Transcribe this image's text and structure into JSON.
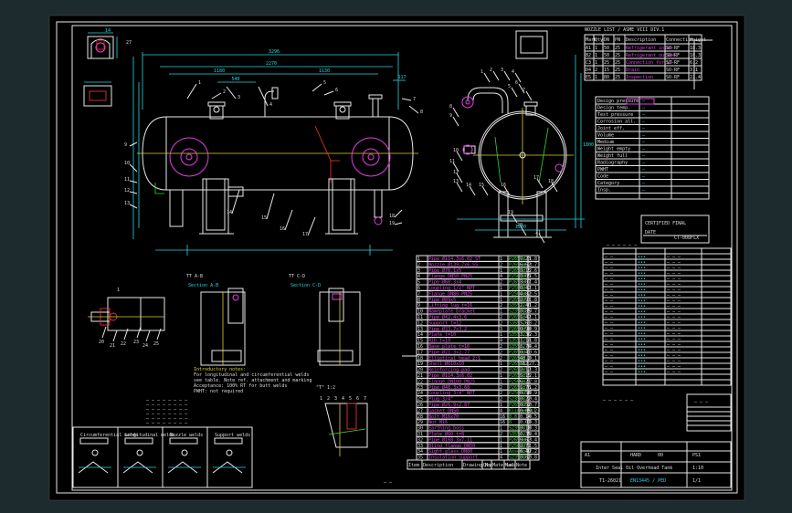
{
  "drawing": {
    "section_ab": "Section A-B",
    "section_cd": "Section C-D",
    "detail_title": "\"Y\" 1:2",
    "section_ab_scale": "TT A-B",
    "section_cd_scale": "TT C-D",
    "view_label": "\"T\" 1:2"
  },
  "callouts": {
    "main_view": [
      "1",
      "2",
      "3",
      "4",
      "5",
      "6",
      "7",
      "8",
      "9",
      "10",
      "11",
      "12",
      "13",
      "14",
      "15",
      "16",
      "17",
      "18",
      "19",
      "20",
      "21",
      "22",
      "23",
      "24",
      "25",
      "26",
      "27",
      "28",
      "29",
      "30",
      "31",
      "32",
      "33",
      "34",
      "35"
    ],
    "side_view": [
      "1",
      "2",
      "3",
      "4",
      "5",
      "6",
      "7",
      "8",
      "9",
      "10",
      "11",
      "12",
      "13",
      "14",
      "15",
      "16",
      "17",
      "18",
      "19",
      "20",
      "21"
    ],
    "detail_view": [
      "1",
      "2",
      "3",
      "4",
      "5",
      "6",
      "7"
    ]
  },
  "dimensions": {
    "overall_length": "3296",
    "shell_length": "2950",
    "top_a": "2270",
    "top_b": "1180",
    "top_c": "1130",
    "top_d": "540",
    "side_width": "1200",
    "side_height": "1800",
    "nozzle": "117"
  },
  "certificate": {
    "title": "CERTIFIED FINAL",
    "line1": "DATE",
    "line2": "CT-008FLX"
  },
  "nozzle_table": {
    "header": [
      "Mark",
      "Qty",
      "DN",
      "PN",
      "Description",
      "Connection",
      "Weight"
    ],
    "rows": [
      [
        "A1",
        "1",
        "50",
        "25",
        "Refrigerant inlet",
        "SO-RF",
        "18.3"
      ],
      [
        "B2",
        "1",
        "50",
        "25",
        "Refrigerant outlet",
        "SO-RF",
        "18.3"
      ],
      [
        "C3",
        "1",
        "25",
        "25",
        "Connection for LT",
        "SO-RF",
        "6.2"
      ],
      [
        "D4",
        "2",
        "15",
        "25",
        "Drain",
        "SO-RF",
        "3.1"
      ],
      [
        "E5",
        "1",
        "80",
        "25",
        "Inspection",
        "SO-RF",
        "22.4"
      ]
    ]
  },
  "parts_list": {
    "header": [
      "Pos",
      "Description",
      "Qty",
      "Material",
      "Mass",
      "Note"
    ],
    "rows": [
      [
        "1",
        "Pipe Ø114.3x6.02 ST",
        "1",
        "P265GH",
        "7.23",
        "1.8"
      ],
      [
        "2",
        "Nozzle Ø139.7x6.55",
        "2",
        "P265GH",
        "6.62",
        "3.7"
      ],
      [
        "3",
        "Pipe Ø76.1x5",
        "1",
        "P265GH",
        "3.15",
        "2.6"
      ],
      [
        "4",
        "Flange DN50 PN25",
        "4",
        "P250GH",
        "3.05",
        "1.5"
      ],
      [
        "5",
        "Pipe Ø60.3x4",
        "2",
        "P265GH",
        "3.07",
        "1.4"
      ],
      [
        "6",
        "Coupling 1/2\" NPT",
        "1",
        "P250GH",
        "0.42",
        "1.1"
      ],
      [
        "7",
        "Flange DN80 PN25",
        "1",
        "P250GH",
        "4.82",
        "2.5"
      ],
      [
        "8",
        "Pipe Ø89x5",
        "1",
        "P265GH",
        "2.91",
        "1.8"
      ],
      [
        "9",
        "Lifting lug t=16",
        "2",
        "S355J2",
        "2.40",
        "1.2"
      ],
      [
        "10",
        "Nameplate bracket",
        "1",
        "S235JR",
        "0.85",
        "0.7"
      ],
      [
        "11",
        "Pipe Ø42.4x3.6",
        "2",
        "P265GH",
        "1.42",
        "1.1"
      ],
      [
        "12",
        "Support t=12",
        "2",
        "S355J2",
        "5.61",
        "3.2"
      ],
      [
        "13",
        "Pipe Ø33.7x3.2",
        "3",
        "P265GH",
        "0.98",
        "0.9"
      ],
      [
        "14",
        "Plate t=10",
        "1",
        "S355J2",
        "3.36",
        "2.3"
      ],
      [
        "15",
        "Rib t=10",
        "4",
        "S355J2",
        "1.14",
        "1.8"
      ],
      [
        "16",
        "Base plate t=16",
        "2",
        "S355J2",
        "8.76",
        "4.4"
      ],
      [
        "17",
        "Pipe Ø21.3x2.77",
        "2",
        "P265GH",
        "0.41",
        "0.6"
      ],
      [
        "18",
        "Elliptical head 2:1",
        "2",
        "P265GH",
        "48.2",
        "9.1"
      ],
      [
        "19",
        "Shell Ø610x10",
        "1",
        "P265GH",
        "312",
        "27.3"
      ],
      [
        "20",
        "Reinforcing pad",
        "2",
        "P265GH",
        "2.12",
        "1.3"
      ],
      [
        "21",
        "Pipe Ø114.3x6.02",
        "1",
        "P265GH",
        "5.15",
        "2.1"
      ],
      [
        "22",
        "Flange DN100 PN25",
        "1",
        "P250GH",
        "6.21",
        "2.8"
      ],
      [
        "23",
        "Pipe Ø48.3x3.68",
        "2",
        "P265GH",
        "1.76",
        "1.2"
      ],
      [
        "24",
        "Coupling 3/4\" NPT",
        "2",
        "P250GH",
        "0.58",
        "0.9"
      ],
      [
        "25",
        "Plug 3/4\"",
        "2",
        "S235JR",
        "0.22",
        "0.4"
      ],
      [
        "26",
        "Pipe Ø26.9x2.87",
        "1",
        "P265GH",
        "0.52",
        "0.7"
      ],
      [
        "27",
        "Gasket DN50",
        "4",
        "Klingersil",
        "0.05",
        "0.2"
      ],
      [
        "28",
        "Bolt M16x70",
        "16",
        "8.8",
        "0.14",
        "0.5"
      ],
      [
        "29",
        "Nut M16",
        "16",
        "8",
        "0.03",
        "0.3"
      ],
      [
        "30",
        "Earthing boss",
        "1",
        "S235JR",
        "0.18",
        "0.3"
      ],
      [
        "31",
        "Plate Ø60 t=8",
        "2",
        "S355J2",
        "0.35",
        "0.4"
      ],
      [
        "32",
        "Pipe Ø168.3x7.11",
        "1",
        "P265GH",
        "9.62",
        "3.4"
      ],
      [
        "33",
        "Blind flange DN50",
        "1",
        "P250GH",
        "2.71",
        "1.5"
      ],
      [
        "34",
        "Sight glass DN80",
        "1",
        "Assembly",
        "6.40",
        "2.2"
      ],
      [
        "35",
        "Insulation support",
        "4",
        "S235JR",
        "0.62",
        "0.8"
      ]
    ],
    "footer": [
      "Item",
      "Description",
      "Drawing No.",
      "Qty",
      "Material",
      "Mass",
      "Note"
    ]
  },
  "title_block": {
    "company": "HARD",
    "drawing_title": "Inter Seal Oil Overhead Tank",
    "drawing_no": "T1-26021",
    "sheet": "1/1",
    "scale": "1:10",
    "format": "A1",
    "rev": "00",
    "code": "PS1",
    "project": "EN13445 / PED"
  },
  "welds": [
    {
      "label": "Circumferential welds"
    },
    {
      "label": "Longitudinal welds"
    },
    {
      "label": "Nozzle welds"
    },
    {
      "label": "Support welds"
    }
  ],
  "notes": [
    "Introductory notes:",
    "For longitudinal and circumferential welds",
    "see table. Note ref. attachment and marking",
    "Acceptance: 100% RT for butt welds",
    "PWHT: not required"
  ]
}
